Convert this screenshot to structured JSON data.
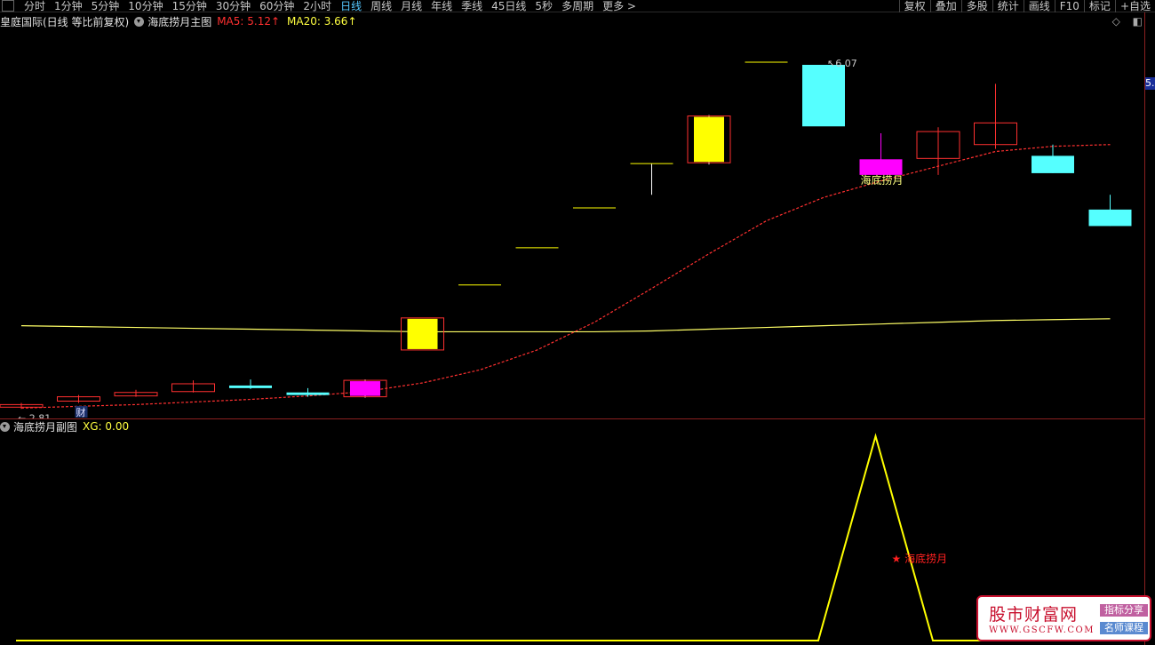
{
  "toolbar": {
    "periods": [
      "分时",
      "1分钟",
      "5分钟",
      "10分钟",
      "15分钟",
      "30分钟",
      "60分钟",
      "2小时",
      "日线",
      "周线",
      "月线",
      "年线",
      "季线",
      "45日线",
      "5秒",
      "多周期",
      "更多 >"
    ],
    "active_period": "日线",
    "tools": [
      "复权",
      "叠加",
      "多股",
      "统计",
      "画线",
      "F10",
      "标记",
      "+自选"
    ]
  },
  "main_panel": {
    "title": "皇庭国际(日线 等比前复权)",
    "indicator": "海底捞月主图",
    "ma5_label": "MA5: 5.12↑",
    "ma20_label": "MA20: 3.66↑",
    "right_icons": [
      "◇",
      "◧"
    ],
    "price_tag": "5.",
    "high_label": "6.07",
    "low_label": "2.81",
    "signal_label": "海底捞月",
    "cai_badge": "财",
    "colors": {
      "up": "#ff3030",
      "down": "#55ffff",
      "yellow": "#ffff00",
      "magenta": "#ff00ff",
      "ma20": "#ff3030",
      "ma_long": "#ffff66"
    }
  },
  "chart_data": {
    "type": "candlestick",
    "candles": [
      {
        "o": 2.83,
        "c": 2.86,
        "h": 2.88,
        "l": 2.81,
        "style": "up"
      },
      {
        "o": 2.9,
        "c": 2.95,
        "h": 2.97,
        "l": 2.88,
        "style": "up"
      },
      {
        "o": 2.96,
        "c": 3.0,
        "h": 3.03,
        "l": 2.95,
        "style": "up"
      },
      {
        "o": 3.01,
        "c": 3.1,
        "h": 3.14,
        "l": 3.0,
        "style": "up"
      },
      {
        "o": 3.08,
        "c": 3.05,
        "h": 3.15,
        "l": 3.04,
        "style": "down"
      },
      {
        "o": 3.0,
        "c": 2.97,
        "h": 3.05,
        "l": 2.95,
        "style": "down"
      },
      {
        "o": 3.14,
        "c": 2.95,
        "h": 3.15,
        "l": 2.94,
        "style": "magenta-box"
      },
      {
        "o": 3.49,
        "c": 3.86,
        "h": 3.86,
        "l": 3.49,
        "style": "yellow-box"
      },
      {
        "o": 4.24,
        "c": 4.24,
        "h": 4.24,
        "l": 4.24,
        "style": "flat"
      },
      {
        "o": 4.67,
        "c": 4.67,
        "h": 4.67,
        "l": 4.67,
        "style": "flat"
      },
      {
        "o": 5.13,
        "c": 5.13,
        "h": 5.13,
        "l": 5.13,
        "style": "flat"
      },
      {
        "o": 5.64,
        "c": 5.64,
        "h": 5.64,
        "l": 5.28,
        "style": "flat"
      },
      {
        "o": 5.65,
        "c": 6.19,
        "h": 6.2,
        "l": 5.63,
        "style": "yellow-box"
      },
      {
        "o": 6.81,
        "c": 6.81,
        "h": 6.81,
        "l": 6.81,
        "style": "flat"
      },
      {
        "o": 6.78,
        "c": 6.07,
        "h": 6.78,
        "l": 6.07,
        "style": "down"
      },
      {
        "o": 5.69,
        "c": 5.51,
        "h": 5.99,
        "l": 5.51,
        "style": "magenta"
      },
      {
        "o": 5.7,
        "c": 6.01,
        "h": 6.06,
        "l": 5.51,
        "style": "up"
      },
      {
        "o": 5.86,
        "c": 6.11,
        "h": 6.56,
        "l": 5.81,
        "style": "up"
      },
      {
        "o": 5.73,
        "c": 5.53,
        "h": 5.86,
        "l": 5.53,
        "style": "down"
      },
      {
        "o": 5.11,
        "c": 4.92,
        "h": 5.28,
        "l": 4.92,
        "style": "down"
      }
    ],
    "ma20": [
      2.82,
      2.84,
      2.86,
      2.89,
      2.92,
      2.96,
      3.01,
      3.11,
      3.26,
      3.49,
      3.81,
      4.2,
      4.6,
      4.98,
      5.25,
      5.44,
      5.61,
      5.78,
      5.84,
      5.86
    ],
    "ma_long": [
      3.77,
      3.76,
      3.75,
      3.74,
      3.73,
      3.72,
      3.71,
      3.7,
      3.7,
      3.7,
      3.7,
      3.71,
      3.73,
      3.75,
      3.77,
      3.79,
      3.81,
      3.83,
      3.84,
      3.85
    ],
    "ylim": [
      2.7,
      7.2
    ]
  },
  "sub_panel": {
    "indicator": "海底捞月副图",
    "xg_label": "XG: 0.00",
    "signal_label": "★ 海底捞月",
    "chart_data": {
      "type": "line",
      "peak_day_index": 15,
      "values": [
        0,
        0,
        0,
        0,
        0,
        0,
        0,
        0,
        0,
        0,
        0,
        0,
        0,
        0,
        0,
        1,
        0,
        0,
        0,
        0
      ]
    }
  },
  "watermark": {
    "main": "股市财富网",
    "url": "WWW.GSCFW.COM",
    "tag1": "指标分享",
    "tag2": "名师课程"
  }
}
